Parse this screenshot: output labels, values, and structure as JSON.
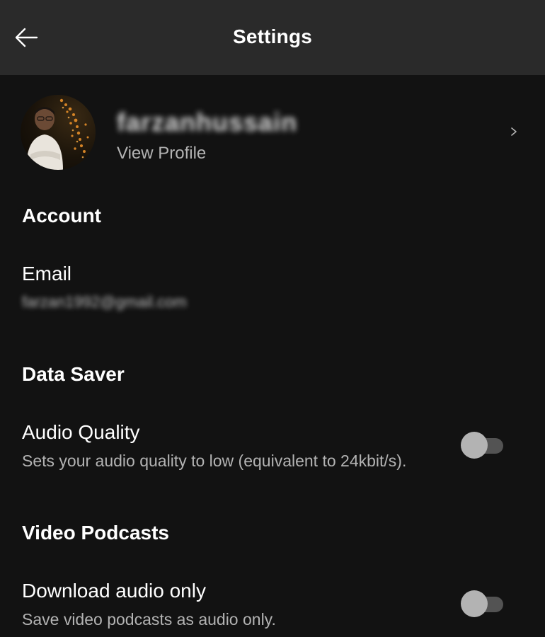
{
  "header": {
    "title": "Settings",
    "back_icon": "arrow-left-icon"
  },
  "profile": {
    "name": "farzanhussain",
    "subtitle": "View Profile",
    "chevron_icon": "chevron-right-icon"
  },
  "sections": {
    "account": {
      "heading": "Account",
      "email_label": "Email",
      "email_value": "farzan1992@gmail.com"
    },
    "data_saver": {
      "heading": "Data Saver",
      "audio_quality_label": "Audio Quality",
      "audio_quality_desc": "Sets your audio quality to low (equivalent to 24kbit/s).",
      "audio_quality_enabled": false
    },
    "video_podcasts": {
      "heading": "Video Podcasts",
      "download_audio_label": "Download audio only",
      "download_audio_desc": "Save video podcasts as audio only.",
      "download_audio_enabled": false
    }
  },
  "colors": {
    "background": "#121212",
    "header_bg": "#2a2a2a",
    "secondary_text": "#b3b3b3",
    "toggle_track": "#535353",
    "toggle_knob": "#b3b3b3"
  }
}
